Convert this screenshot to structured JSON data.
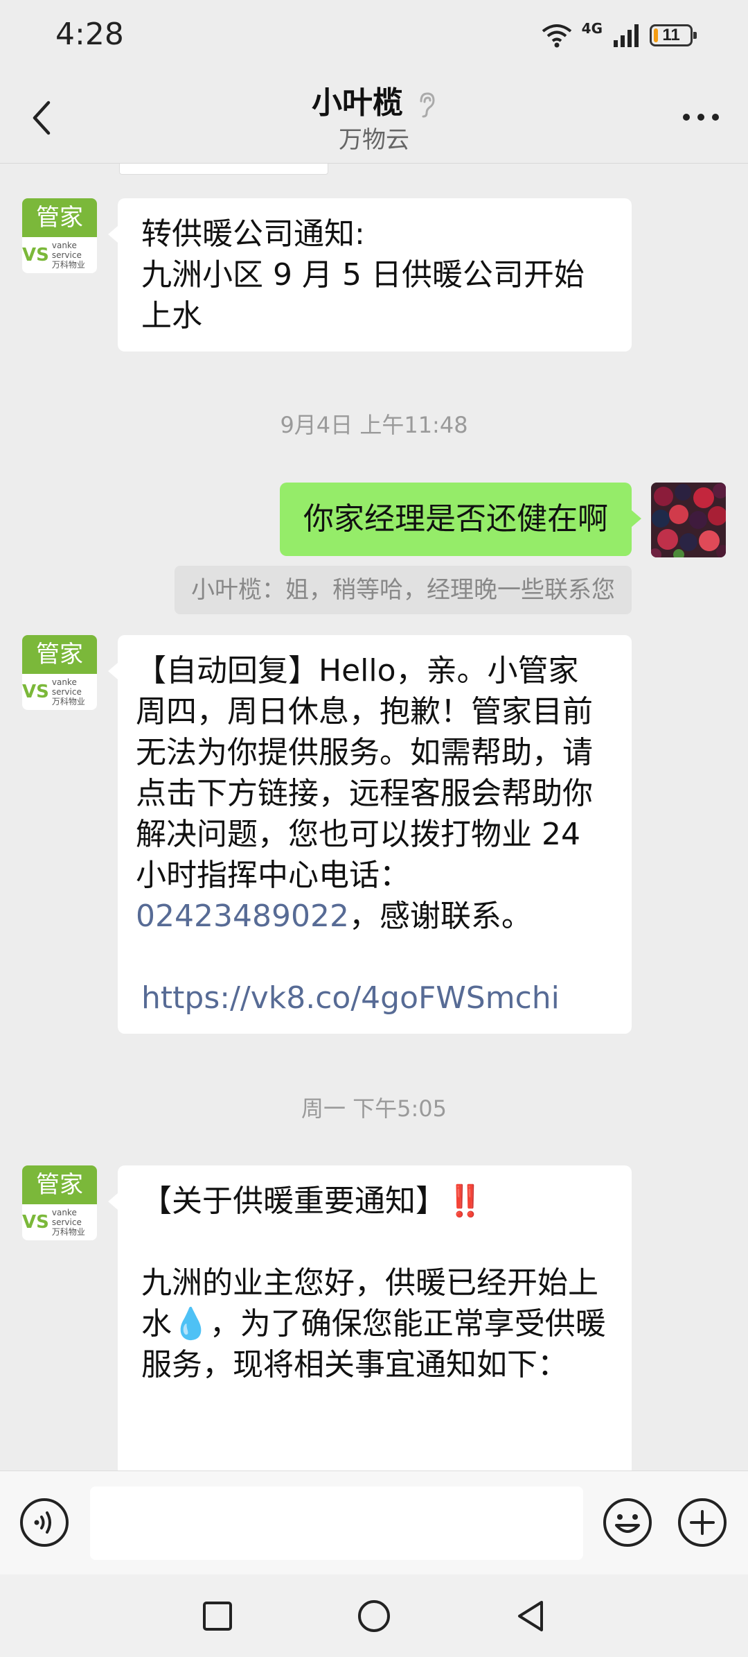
{
  "status_bar": {
    "time": "4:28",
    "network": "4G",
    "battery": "11",
    "battery_level": 0.11
  },
  "header": {
    "title": "小叶榄",
    "subtitle": "万物云"
  },
  "avatar": {
    "label": "管家",
    "brand": "万科物业",
    "brand_en": "vanke service",
    "logo": "VS"
  },
  "messages": {
    "m1": {
      "line1": "转供暖公司通知:",
      "line2": "九洲小区 9 月 5 日供暖公司开始上水"
    },
    "ts1": "9月4日 上午11:48",
    "m2": "你家经理是否还健在啊",
    "quote": "小叶榄：姐，稍等哈，经理晚一些联系您",
    "m3": {
      "text_before_phone": "【自动回复】Hello，亲。小管家周四，周日休息，抱歉！管家目前无法为你提供服务。如需帮助，请点击下方链接，远程客服会帮助你解决问题，您也可以拨打物业 24 小时指挥中心电话：",
      "phone": "02423489022",
      "text_after_phone": "，感谢联系。",
      "url": "https://vk8.co/4goFWSmchi"
    },
    "ts2": "周一 下午5:05",
    "m4": {
      "heading": "【关于供暖重要通知】",
      "heading_emoji": "‼️",
      "body_part1": "九洲的业主您好，供暖已经开始上水",
      "droplet_emoji": "💧",
      "body_part2": "，为了确保您能正常享受供暖服务，现将相关事宜通知如下："
    }
  },
  "colors": {
    "self_bubble": "#95ec69",
    "link": "#576b95",
    "brand_green": "#7bb83a",
    "background": "#ededed"
  },
  "icons": {
    "back": "chevron-left-icon",
    "ear": "ear-icon",
    "more": "more-icon",
    "voice": "voice-icon",
    "emoji": "emoji-icon",
    "plus": "plus-icon",
    "nav_recent": "square-icon",
    "nav_home": "circle-icon",
    "nav_back": "triangle-back-icon"
  }
}
